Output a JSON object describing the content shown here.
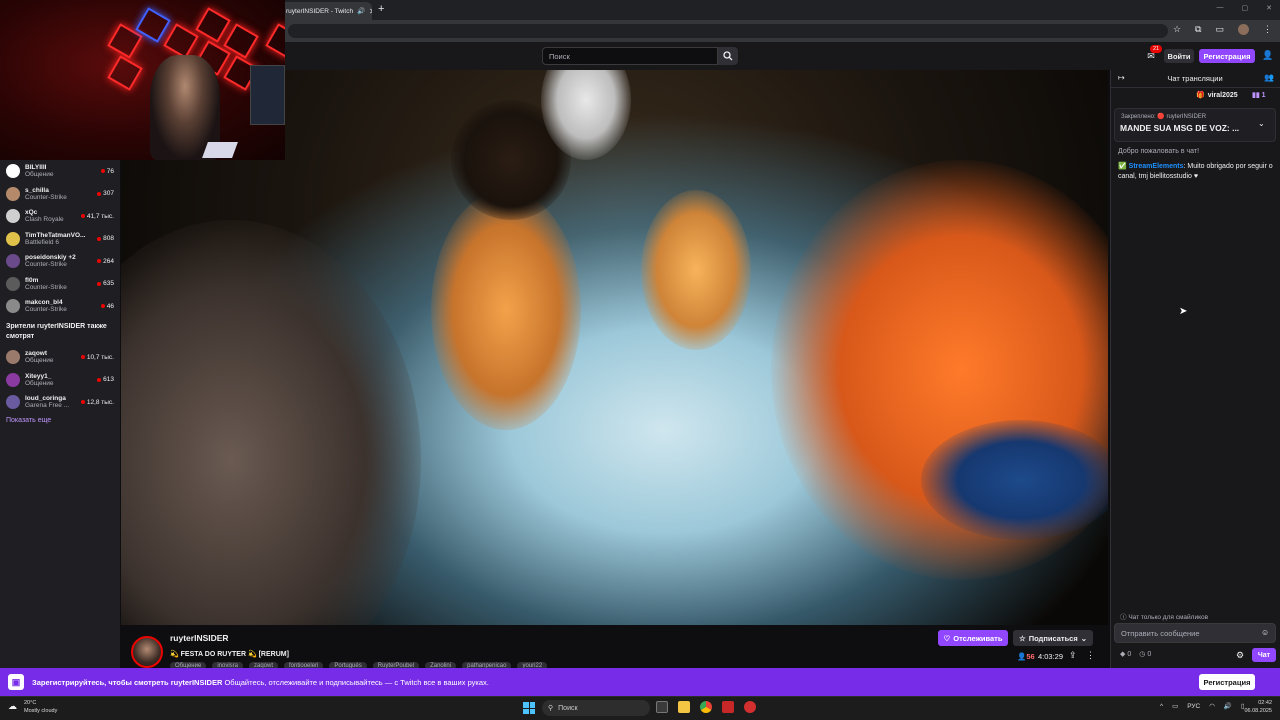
{
  "browser": {
    "tab_title": "ruyterINSIDER - Twitch",
    "tab_audio_icon": "speaker-icon",
    "new_tab": "+",
    "window_controls": [
      "—",
      "▢",
      "✕"
    ]
  },
  "topnav": {
    "search_placeholder": "Поиск",
    "notifications_count": "21",
    "login_label": "Войти",
    "signup_label": "Регистрация"
  },
  "sidebar": {
    "channels": [
      {
        "name": "BILYIIII",
        "category": "Общение",
        "viewers": "76",
        "color": "#ffffff"
      },
      {
        "name": "s_chilla",
        "category": "Counter-Strike",
        "viewers": "307",
        "color": "#b58a6a"
      },
      {
        "name": "xQc",
        "category": "Clash Royale",
        "viewers": "41,7 тыс.",
        "color": "#cfcfcf"
      },
      {
        "name": "TimTheTatmanVO...",
        "category": "Battlefield 6",
        "viewers": "808",
        "color": "#e0c24b"
      },
      {
        "name": "poseidonskiy +2",
        "category": "Counter-Strike",
        "viewers": "264",
        "color": "#6a4a8a"
      },
      {
        "name": "fl0m",
        "category": "Counter-Strike",
        "viewers": "635",
        "color": "#5b5b5b"
      },
      {
        "name": "makcon_bl4",
        "category": "Counter-Strike",
        "viewers": "46",
        "color": "#8a8a8a"
      }
    ],
    "heading": "Зрители ruyterINSIDER также смотрят",
    "recommended": [
      {
        "name": "zaqowt",
        "category": "Общение",
        "viewers": "10,7 тыс.",
        "color": "#9a7a6a"
      },
      {
        "name": "Xiteyy1_",
        "category": "Общение",
        "viewers": "613",
        "color": "#8a3aa0"
      },
      {
        "name": "loud_coringa",
        "category": "Garena Free ...",
        "viewers": "12,8 тыс.",
        "color": "#6a5aa0"
      }
    ],
    "show_more": "Показать еще"
  },
  "stream": {
    "streamer_name": "ruyterINSIDER",
    "title": "💫 FESTA DO RUYTER 💫 [RERUM]",
    "tags": [
      "Общение",
      "inovisra",
      "zaqowt",
      "fontiooeleri",
      "Portugués",
      "RuyterPoubel",
      "Zanolini",
      "pathanpenicao",
      "youri22"
    ],
    "follow_label": "Отслеживать",
    "subscribe_label": "Подписаться",
    "viewers": "56",
    "uptime": "4:03:29"
  },
  "chat": {
    "header": "Чат трансляции",
    "gifter_name": "viral2025",
    "gift_count": "1",
    "pinned_label": "Закреплено: 🔴 ruyterINSIDER",
    "pinned_message": "MANDE SUA MSG DE VOZ: ...",
    "welcome": "Добро пожаловать в чат!",
    "message_user": "StreamElements",
    "message_text": "Muito obrigado por seguir o canal, tmj biellitosstudio ♥",
    "emote_only": "Чат только для смайликов",
    "input_placeholder": "Отправить сообщение",
    "points_a": "0",
    "points_b": "0",
    "chat_button": "Чат"
  },
  "banner": {
    "text_bold": "Зарегистрируйтесь, чтобы смотреть ruyterINSIDER",
    "text_rest": " Общайтесь, отслеживайте и подписывайтесь — с Twitch все в ваших руках.",
    "button": "Регистрация"
  },
  "taskbar": {
    "temp": "20°C",
    "weather": "Mostly cloudy",
    "search": "Поиск",
    "lang": "РУС",
    "time": "02:42",
    "date": "06.08.2025"
  },
  "colors": {
    "accent": "#9147ff",
    "live": "#eb0400",
    "banner": "#772ce8"
  }
}
